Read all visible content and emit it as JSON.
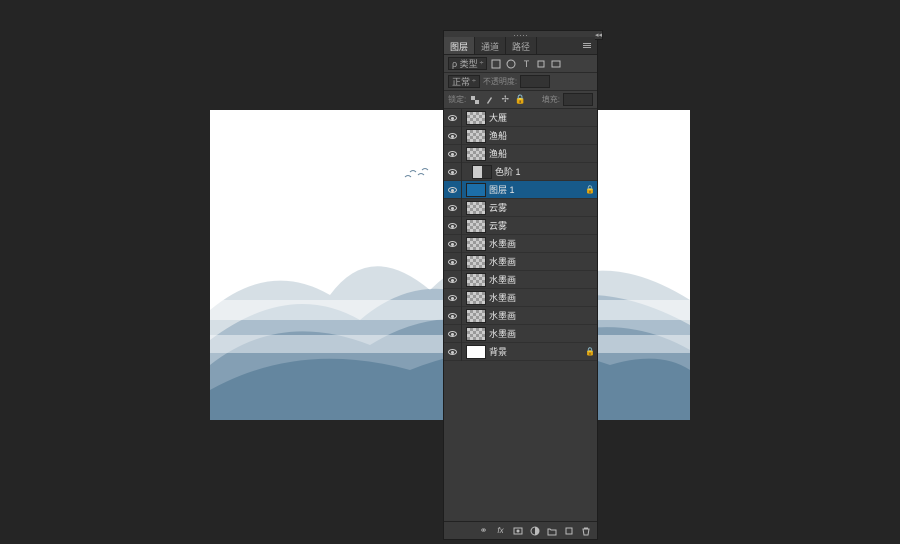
{
  "tabs": {
    "layers": "图层",
    "channels": "通道",
    "paths": "路径"
  },
  "filter": {
    "label": "ρ 类型",
    "chev": "÷"
  },
  "blend": {
    "mode": "正常",
    "opacity_label": "不透明度:",
    "opacity_value": ""
  },
  "lock": {
    "label": "锁定:",
    "fill_label": "填充:",
    "fill_value": ""
  },
  "layers": [
    {
      "name": "大雁",
      "selected": false,
      "locked": false,
      "thumb": "checker",
      "indent": false
    },
    {
      "name": "渔船",
      "selected": false,
      "locked": false,
      "thumb": "checker",
      "indent": false
    },
    {
      "name": "渔船",
      "selected": false,
      "locked": false,
      "thumb": "checker",
      "indent": false
    },
    {
      "name": "色阶 1",
      "selected": false,
      "locked": false,
      "thumb": "half",
      "indent": true
    },
    {
      "name": "图层 1",
      "selected": true,
      "locked": true,
      "thumb": "blue",
      "indent": false
    },
    {
      "name": "云雾",
      "selected": false,
      "locked": false,
      "thumb": "checker",
      "indent": false
    },
    {
      "name": "云雾",
      "selected": false,
      "locked": false,
      "thumb": "checker",
      "indent": false
    },
    {
      "name": "水墨画",
      "selected": false,
      "locked": false,
      "thumb": "checker",
      "indent": false
    },
    {
      "name": "水墨画",
      "selected": false,
      "locked": false,
      "thumb": "checker",
      "indent": false
    },
    {
      "name": "水墨画",
      "selected": false,
      "locked": false,
      "thumb": "checker",
      "indent": false
    },
    {
      "name": "水墨画",
      "selected": false,
      "locked": false,
      "thumb": "checker",
      "indent": false
    },
    {
      "name": "水墨画",
      "selected": false,
      "locked": false,
      "thumb": "checker",
      "indent": false
    },
    {
      "name": "水墨画",
      "selected": false,
      "locked": false,
      "thumb": "checker",
      "indent": false
    },
    {
      "name": "背景",
      "selected": false,
      "locked": true,
      "thumb": "white",
      "indent": false
    }
  ],
  "footer_icons": [
    "link-icon",
    "fx-icon",
    "mask-icon",
    "adjust-icon",
    "group-icon",
    "new-icon",
    "trash-icon"
  ]
}
